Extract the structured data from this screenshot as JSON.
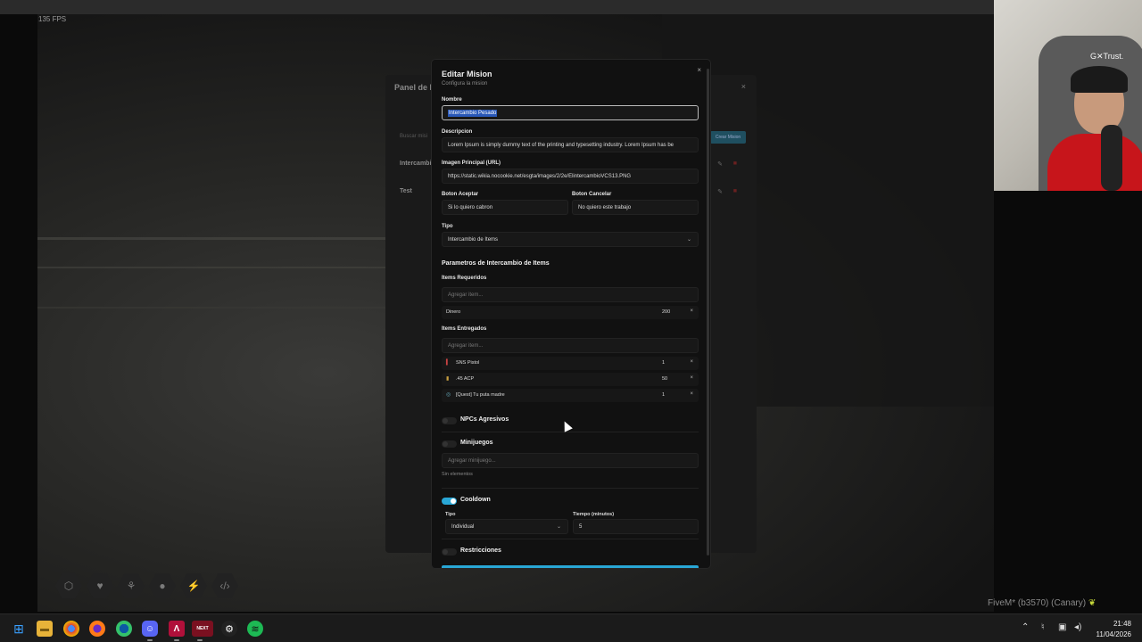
{
  "game": {
    "fps": "135 FPS",
    "fivem_label": "FiveM* (b3570) (Canary)",
    "hud_icons": [
      "hex-icon",
      "heart-icon",
      "food-icon",
      "water-icon",
      "energy-icon",
      "code-icon"
    ]
  },
  "webcam": {
    "brand": "G✕Trust."
  },
  "background_panel": {
    "title": "Panel de M",
    "close": "×",
    "search_placeholder": "Buscar misi",
    "new_button": "Crear Mision",
    "rows": [
      "Intercambi",
      "Test"
    ]
  },
  "modal": {
    "title": "Editar Mision",
    "subtitle": "Configura la mision",
    "close": "×",
    "nombre_label": "Nombre",
    "nombre_value": "Intercambio Pesado",
    "descripcion_label": "Descripcion",
    "descripcion_value": "Lorem Ipsum is simply dummy text of the printing and typesetting industry. Lorem Ipsum has be",
    "imagen_label": "Imagen Principal (URL)",
    "imagen_value": "https://static.wikia.nocookie.net/esgta/images/2/2e/ElintercambioVCS13.PNG",
    "boton_aceptar_label": "Boton Aceptar",
    "boton_aceptar_value": "Si lo quiero cabron",
    "boton_cancelar_label": "Boton Cancelar",
    "boton_cancelar_value": "No quiero este trabajo",
    "tipo_label": "Tipo",
    "tipo_value": "Intercambio de Items",
    "params_title": "Parametros de Intercambio de Items",
    "requeridos_label": "Items Requeridos",
    "add_item_placeholder": "Agregar item...",
    "requeridos": [
      {
        "name": "Dinero",
        "qty": "200"
      }
    ],
    "entregados_label": "Items Entregados",
    "entregados": [
      {
        "icon": "pistol-icon",
        "name": "SNS Pistol",
        "qty": "1"
      },
      {
        "icon": "ammo-icon",
        "name": ".45 ACP",
        "qty": "50"
      },
      {
        "icon": "quest-icon",
        "name": "[Quest] Tu puta madre",
        "qty": "1"
      }
    ],
    "remove_symbol": "×",
    "npcs_label": "NPCs Agresivos",
    "minijuegos_label": "Minijuegos",
    "add_minijuego_placeholder": "Agregar minijuego...",
    "sin_elementos": "Sin elementos",
    "cooldown_label": "Cooldown",
    "cooldown_tipo_label": "Tipo",
    "cooldown_tipo_value": "Individual",
    "cooldown_tiempo_label": "Tiempo (minutos)",
    "cooldown_tiempo_value": "5",
    "restricciones_label": "Restricciones"
  },
  "taskbar": {
    "apps": [
      "windows-start-icon",
      "file-explorer-icon",
      "chrome-icon",
      "firefox-icon",
      "edge-icon",
      "discord-icon",
      "app-a-icon",
      "next-icon",
      "steam-icon",
      "spotify-icon"
    ],
    "next_label": "NEXT",
    "time": "21:48",
    "date": "11/04/2026"
  },
  "colors": {
    "accent": "#29a7d6",
    "selection": "#2958b8"
  }
}
